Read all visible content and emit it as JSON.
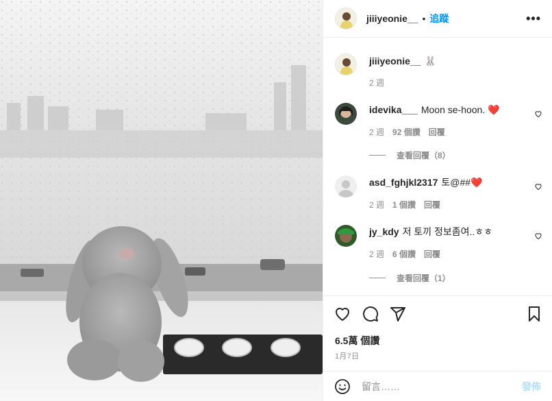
{
  "post": {
    "author": "jiiiyeonie__",
    "separator": "•",
    "follow_label": "追蹤",
    "more_icon": "more-horizontal-icon",
    "caption": {
      "user": "jiiiyeonie__",
      "text": "🐰",
      "time": "2 週"
    },
    "likes": "6.5萬 個讚",
    "date": "1月7日"
  },
  "comments": [
    {
      "user": "idevika___",
      "text": "Moon se-hoon. ❤️",
      "time": "2 週",
      "likes": "92 個讚",
      "reply_label": "回覆",
      "view_replies": "查看回覆（8）"
    },
    {
      "user": "asd_fghjkl2317",
      "text": "토@##❤️",
      "time": "2 週",
      "likes": "1 個讚",
      "reply_label": "回覆",
      "view_replies": ""
    },
    {
      "user": "jy_kdy",
      "text": "저 토끼 정보좀여..ㅎㅎ",
      "time": "2 週",
      "likes": "6 個讚",
      "reply_label": "回覆",
      "view_replies": "查看回覆（1）"
    }
  ],
  "add_comment": {
    "placeholder": "留言……",
    "post_label": "發佈"
  },
  "colors": {
    "accent": "#0095f6",
    "muted": "#8e8e8e",
    "post_disabled": "#b2dffc"
  }
}
